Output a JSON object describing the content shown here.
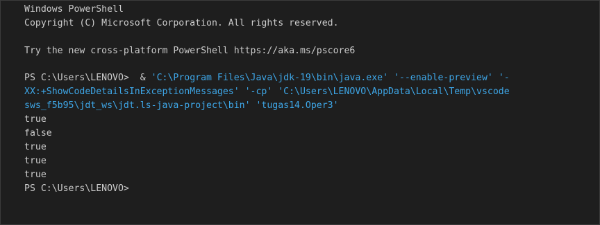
{
  "window": {
    "title_line": "Windows PowerShell",
    "copyright": "Copyright (C) Microsoft Corporation. All rights reserved.",
    "try_message": "Try the new cross-platform PowerShell https://aka.ms/pscore6"
  },
  "command": {
    "prompt": "PS C:\\Users\\LENOVO> ",
    "op": " & ",
    "line1_str": "'C:\\Program Files\\Java\\jdk-19\\bin\\java.exe' '--enable-preview' '-",
    "line2_str": "XX:+ShowCodeDetailsInExceptionMessages' '-cp' 'C:\\Users\\LENOVO\\AppData\\Local\\Temp\\vscode",
    "line3_str": "sws_f5b95\\jdt_ws\\jdt.ls-java-project\\bin' 'tugas14.Oper3'"
  },
  "output": [
    "true",
    "false",
    "true",
    "true",
    "true"
  ],
  "final_prompt": "PS C:\\Users\\LENOVO>",
  "colors": {
    "background": "#1e1e1e",
    "text": "#cccccc",
    "string": "#3ea7e8"
  }
}
